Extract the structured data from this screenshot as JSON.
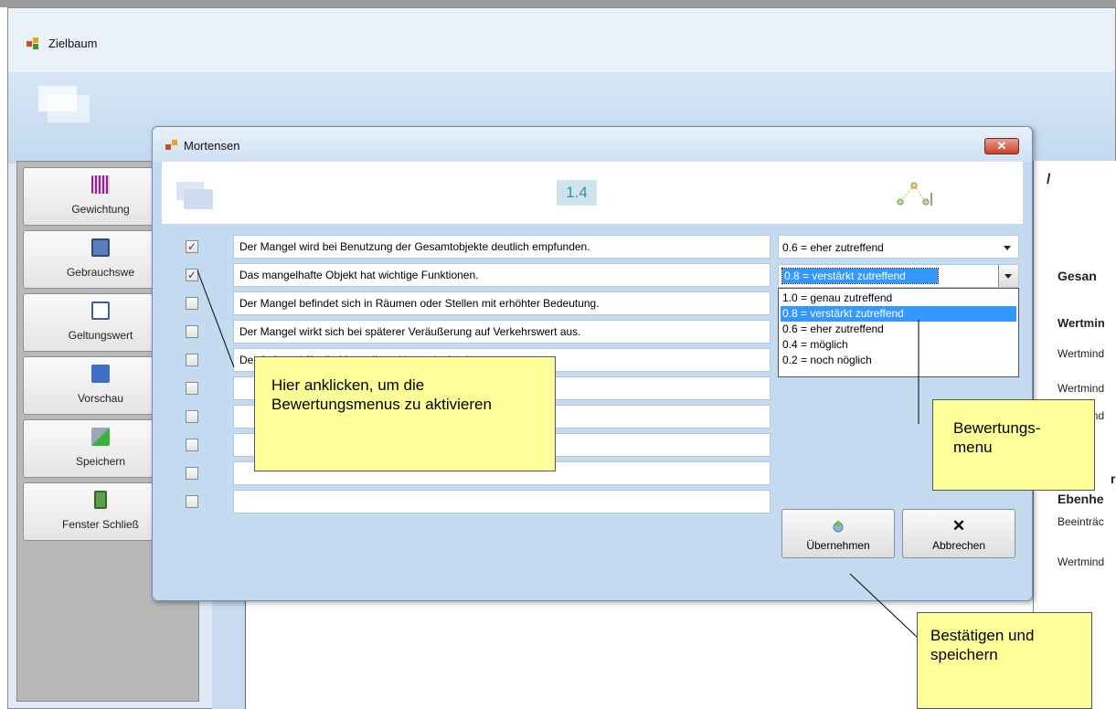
{
  "main_window": {
    "title": "Zielbaum"
  },
  "sidebar": {
    "buttons": [
      {
        "label": "Gewichtung",
        "icon": "weighting-icon"
      },
      {
        "label": "Gebrauchswe",
        "icon": "usage-value-icon"
      },
      {
        "label": "Geltungswert",
        "icon": "validity-value-icon"
      },
      {
        "label": "Vorschau",
        "icon": "preview-icon"
      },
      {
        "label": "Speichern",
        "icon": "save-icon"
      },
      {
        "label": "Fenster Schließ",
        "icon": "door-icon"
      }
    ]
  },
  "right_panel": {
    "slash": "/",
    "heading1": "Gesan",
    "heading2": "Wertmin",
    "line1": "Wertmind",
    "line2": "Wertmind",
    "line3": "Wertmind",
    "heading3": "r",
    "heading4": "Ebenhe",
    "line4": "Beeinträc",
    "line5": "Wertmind"
  },
  "dialog": {
    "title": "Mortensen",
    "close_label": "✕",
    "header_number": "1.4",
    "criteria": [
      {
        "text": "Der Mangel wird bei Benutzung der Gesamtobjekte deutlich empfunden.",
        "checked": true,
        "mark": "✓"
      },
      {
        "text": "Das mangelhafte Objekt hat wichtige Funktionen.",
        "checked": true,
        "mark": "✓"
      },
      {
        "text": "Der Mangel befindet sich in Räumen oder Stellen mit erhöhter Bedeutung.",
        "checked": false,
        "mark": ""
      },
      {
        "text": "Der Mangel wirkt sich bei späterer Veräußerung auf Verkehrswert aus.",
        "checked": false,
        "mark": ""
      },
      {
        "text": "Der Aufwand für die Mangelbeseitigung ist hoch.",
        "checked": false,
        "mark": ""
      },
      {
        "text": "",
        "checked": false,
        "mark": ""
      },
      {
        "text": "",
        "checked": false,
        "mark": ""
      },
      {
        "text": "",
        "checked": false,
        "mark": ""
      },
      {
        "text": "",
        "checked": false,
        "mark": ""
      },
      {
        "text": "",
        "checked": false,
        "mark": ""
      }
    ],
    "rating_row1": "0.6 = eher zutreffend",
    "rating_row2": "0.8 = verstärkt zutreffend",
    "rating_options": [
      "1.0 = genau zutreffend",
      "0.8 = verstärkt zutreffend",
      "0.6 = eher zutreffend",
      "0.4 = möglich",
      "0.2 = noch nöglich"
    ],
    "rating_selected_index": 1,
    "apply_label": "Übernehmen",
    "cancel_label": "Abbrechen",
    "cancel_icon": "✕"
  },
  "callouts": {
    "activate": "Hier anklicken, um die Bewertungsmenus zu aktivieren",
    "menu": "Bewertungs-\nmenu",
    "confirm": "Bestätigen und speichern"
  },
  "colors": {
    "selection": "#3399ff",
    "callout_fill": "#ffff99",
    "dialog_bg": "#c3daf1",
    "header_number_text": "#2e8fae"
  }
}
